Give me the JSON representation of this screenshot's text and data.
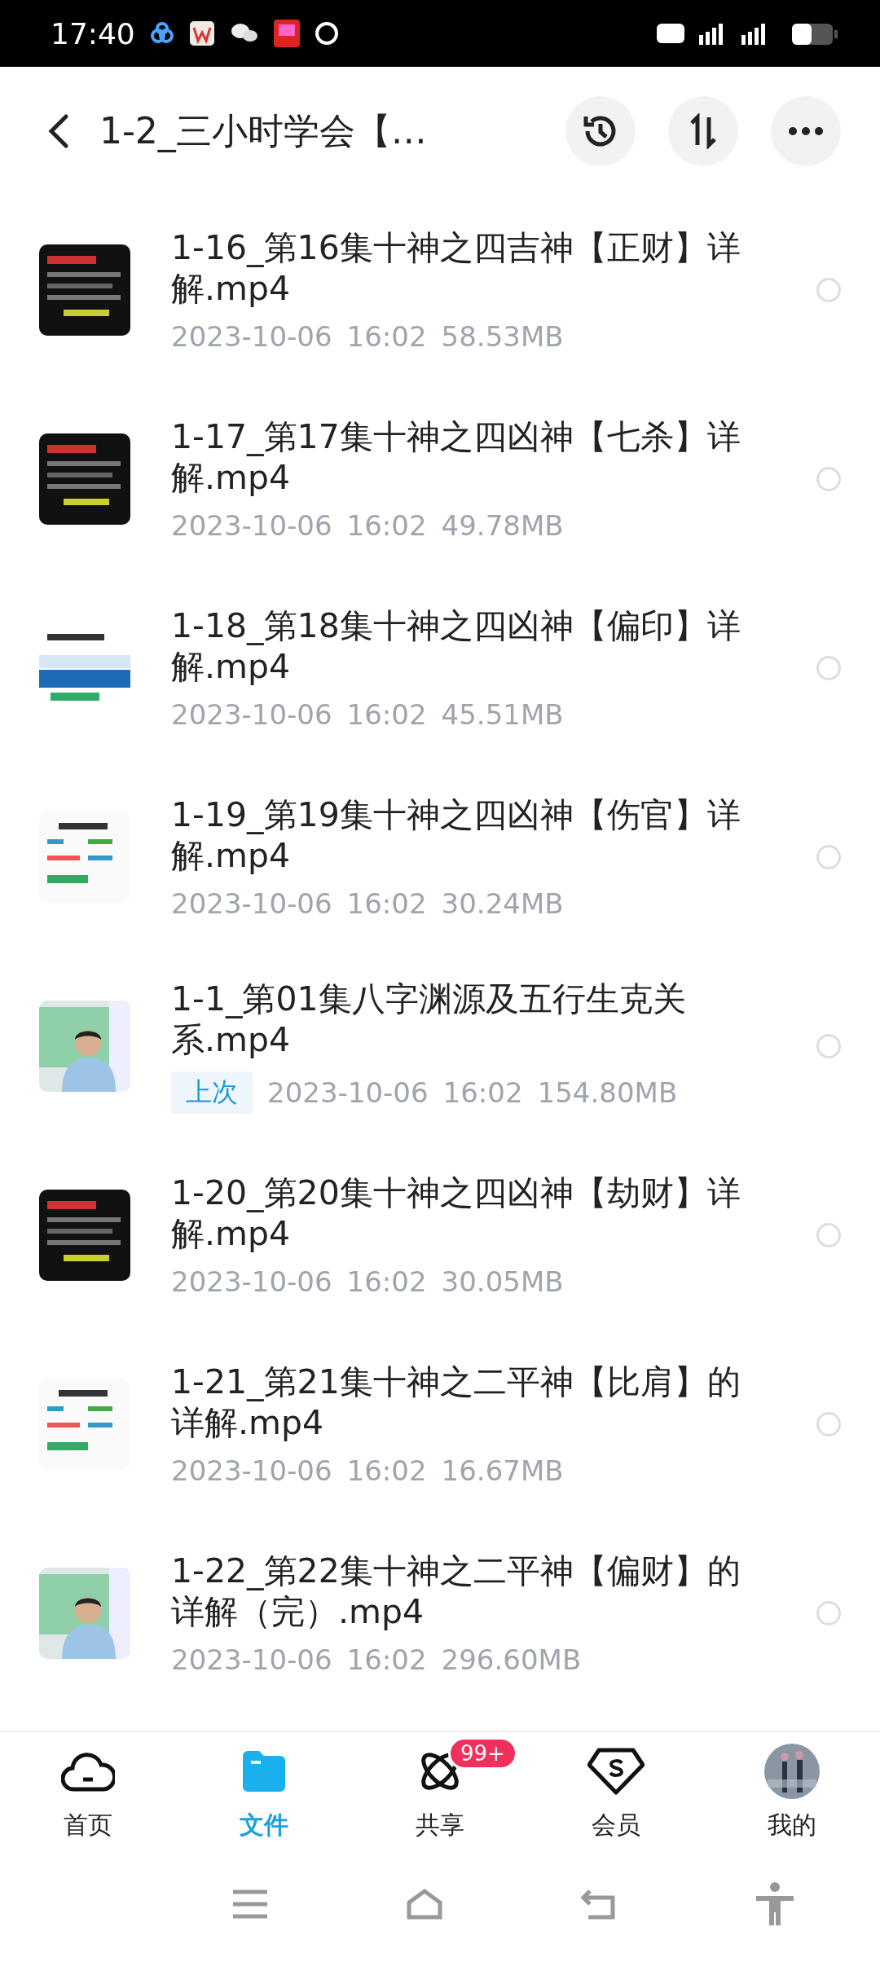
{
  "status_bar": {
    "time": "17:40"
  },
  "header": {
    "title": "1-2_三小时学会【…"
  },
  "files": [
    {
      "title": "1-16_第16集十神之四吉神【正财】详解.mp4",
      "date": "2023-10-06",
      "time": "16:02",
      "size": "58.53MB",
      "thumbnail": {
        "kind": "dark"
      },
      "selected": false
    },
    {
      "title": "1-17_第17集十神之四凶神【七杀】详解.mp4",
      "date": "2023-10-06",
      "time": "16:02",
      "size": "49.78MB",
      "thumbnail": {
        "kind": "dark"
      },
      "selected": false
    },
    {
      "title": "1-18_第18集十神之四凶神【偏印】详解.mp4",
      "date": "2023-10-06",
      "time": "16:02",
      "size": "45.51MB",
      "thumbnail": {
        "kind": "blue"
      },
      "selected": false
    },
    {
      "title": "1-19_第19集十神之四凶神【伤官】详解.mp4",
      "date": "2023-10-06",
      "time": "16:02",
      "size": "30.24MB",
      "thumbnail": {
        "kind": "light"
      },
      "selected": false
    },
    {
      "title": "1-1_第01集八字渊源及五行生克关系.mp4",
      "badge": "上次",
      "date": "2023-10-06",
      "time": "16:02",
      "size": "154.80MB",
      "thumbnail": {
        "kind": "person"
      },
      "selected": false
    },
    {
      "title": "1-20_第20集十神之四凶神【劫财】详解.mp4",
      "date": "2023-10-06",
      "time": "16:02",
      "size": "30.05MB",
      "thumbnail": {
        "kind": "dark"
      },
      "selected": false
    },
    {
      "title": "1-21_第21集十神之二平神【比肩】的详解.mp4",
      "date": "2023-10-06",
      "time": "16:02",
      "size": "16.67MB",
      "thumbnail": {
        "kind": "light"
      },
      "selected": false
    },
    {
      "title": "1-22_第22集十神之二平神【偏财】的详解（完）.mp4",
      "date": "2023-10-06",
      "time": "16:02",
      "size": "296.60MB",
      "thumbnail": {
        "kind": "person"
      },
      "selected": false
    }
  ],
  "nav": [
    {
      "label": "首页",
      "selected": false
    },
    {
      "label": "文件",
      "selected": true
    },
    {
      "label": "共享",
      "selected": false,
      "badge": "99+"
    },
    {
      "label": "会员",
      "selected": false
    },
    {
      "label": "我的",
      "selected": false
    }
  ]
}
